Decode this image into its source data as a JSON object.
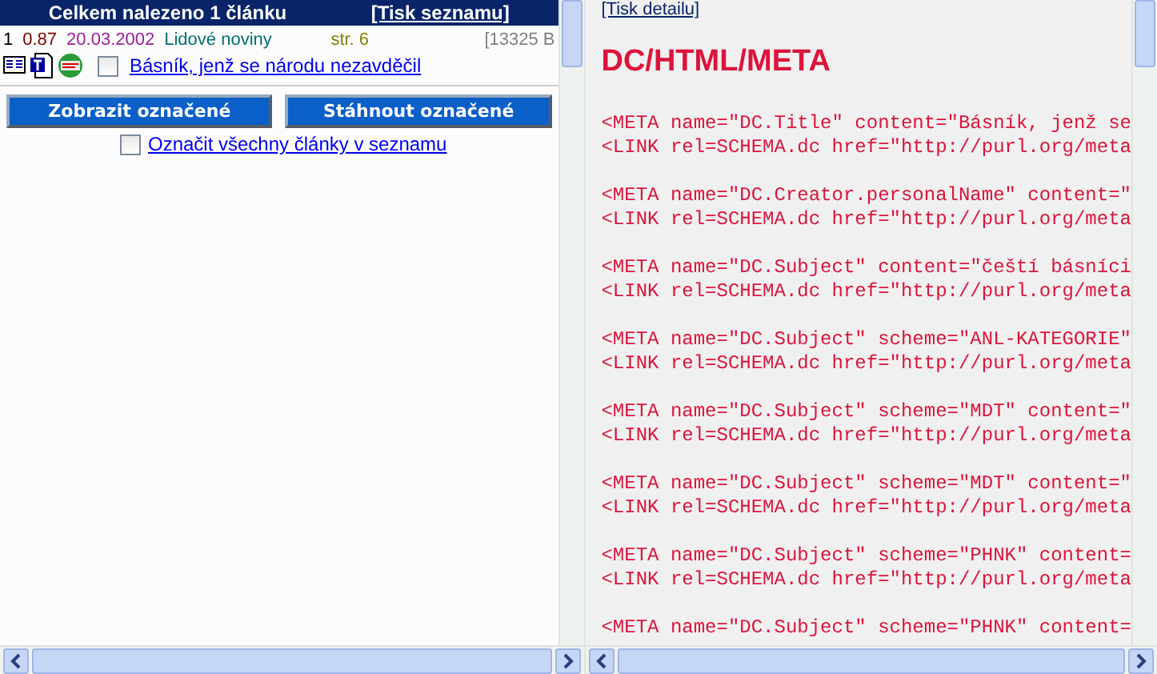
{
  "list_header": {
    "title": "Celkem nalezeno 1 článku",
    "print_link": "[Tisk seznamu]"
  },
  "results": [
    {
      "number": "1",
      "score": "0.87",
      "date": "20.03.2002",
      "source": "Lidové noviny",
      "page": "str. 6",
      "size": "[13325 B",
      "title": "Básník, jenž se národu nezavděčil",
      "checked": false
    }
  ],
  "buttons": [
    "Zobrazit označené",
    "Stáhnout označené"
  ],
  "select_all": {
    "label": "Označit všechny články v seznamu",
    "checked": false
  },
  "detail": {
    "print_link": "[Tisk detailu]",
    "heading": "DC/HTML/META",
    "blocks": [
      [
        "<META name=\"DC.Title\" content=\"Básník, jenž se",
        "<LINK rel=SCHEMA.dc href=\"http://purl.org/meta"
      ],
      [
        "<META name=\"DC.Creator.personalName\" content=\"",
        "<LINK rel=SCHEMA.dc href=\"http://purl.org/meta"
      ],
      [
        "<META name=\"DC.Subject\" content=\"čeští básníci",
        "<LINK rel=SCHEMA.dc href=\"http://purl.org/meta"
      ],
      [
        "<META name=\"DC.Subject\" scheme=\"ANL-KATEGORIE\"",
        "<LINK rel=SCHEMA.dc href=\"http://purl.org/meta"
      ],
      [
        "<META name=\"DC.Subject\" scheme=\"MDT\" content=\"",
        "<LINK rel=SCHEMA.dc href=\"http://purl.org/meta"
      ],
      [
        "<META name=\"DC.Subject\" scheme=\"MDT\" content=\"",
        "<LINK rel=SCHEMA.dc href=\"http://purl.org/meta"
      ],
      [
        "<META name=\"DC.Subject\" scheme=\"PHNK\" content=",
        "<LINK rel=SCHEMA.dc href=\"http://purl.org/meta"
      ],
      [
        "<META name=\"DC.Subject\" scheme=\"PHNK\" content="
      ]
    ]
  }
}
